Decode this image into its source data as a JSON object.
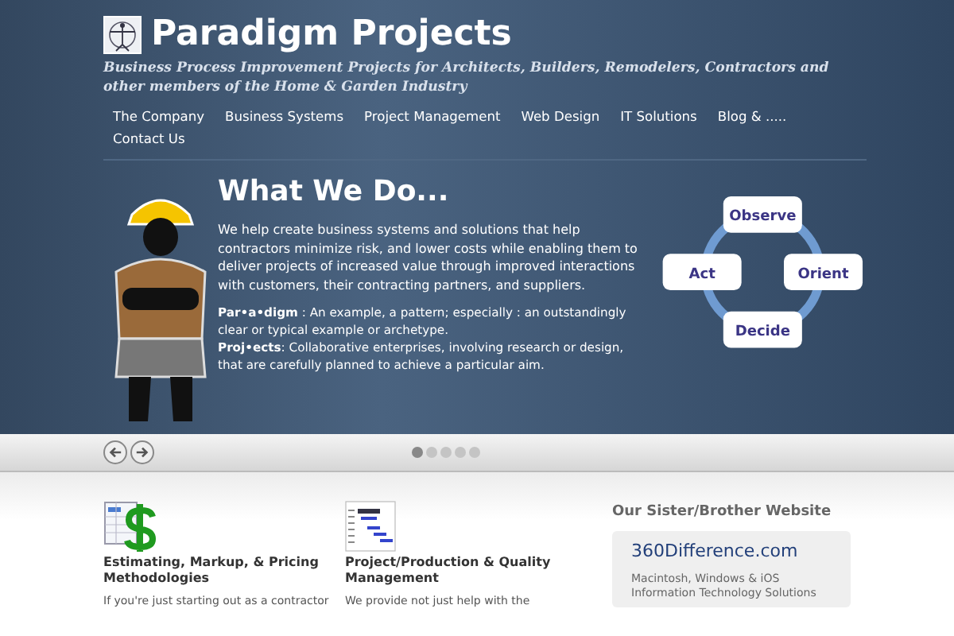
{
  "site": {
    "title": "Paradigm Projects",
    "tagline": "Business Process Improvement Projects for Architects, Builders, Remodelers, Contractors and other members of the Home & Garden Industry"
  },
  "nav": [
    "The Company",
    "Business Systems",
    "Project Management",
    "Web Design",
    "IT Solutions",
    "Blog & .....",
    "Contact Us"
  ],
  "hero": {
    "heading": "What We Do...",
    "intro": "We help create business systems and solutions that help contractors minimize risk, and lower costs while enabling them to deliver projects of increased value through improved interactions with customers, their contracting partners, and suppliers.",
    "definitions": [
      "**Par•a•digm** :  An example, a pattern; especially : an outstandingly clear or typical example or archetype.",
      "**Proj•ects**:  Collaborative enterprises, involving research or design, that are carefully planned to achieve a particular aim."
    ],
    "cycle": [
      "Observe",
      "Orient",
      "Decide",
      "Act"
    ]
  },
  "slider": {
    "dots": [
      {
        "selected": true
      },
      {
        "selected": false
      },
      {
        "selected": false
      },
      {
        "selected": false
      },
      {
        "selected": false
      }
    ]
  },
  "features": [
    {
      "kind": "pricing",
      "title": "Estimating, Markup, & Pricing Methodologies",
      "text": "If you're just starting out as a contractor"
    },
    {
      "kind": "gantt",
      "title": "Project/Production & Quality Management",
      "text": "We provide not just help with the"
    }
  ],
  "sidebar": {
    "heading": "Our Sister/Brother Website",
    "link": "360Difference.com",
    "text": "Macintosh, Windows & iOS Information Technology Solutions"
  }
}
